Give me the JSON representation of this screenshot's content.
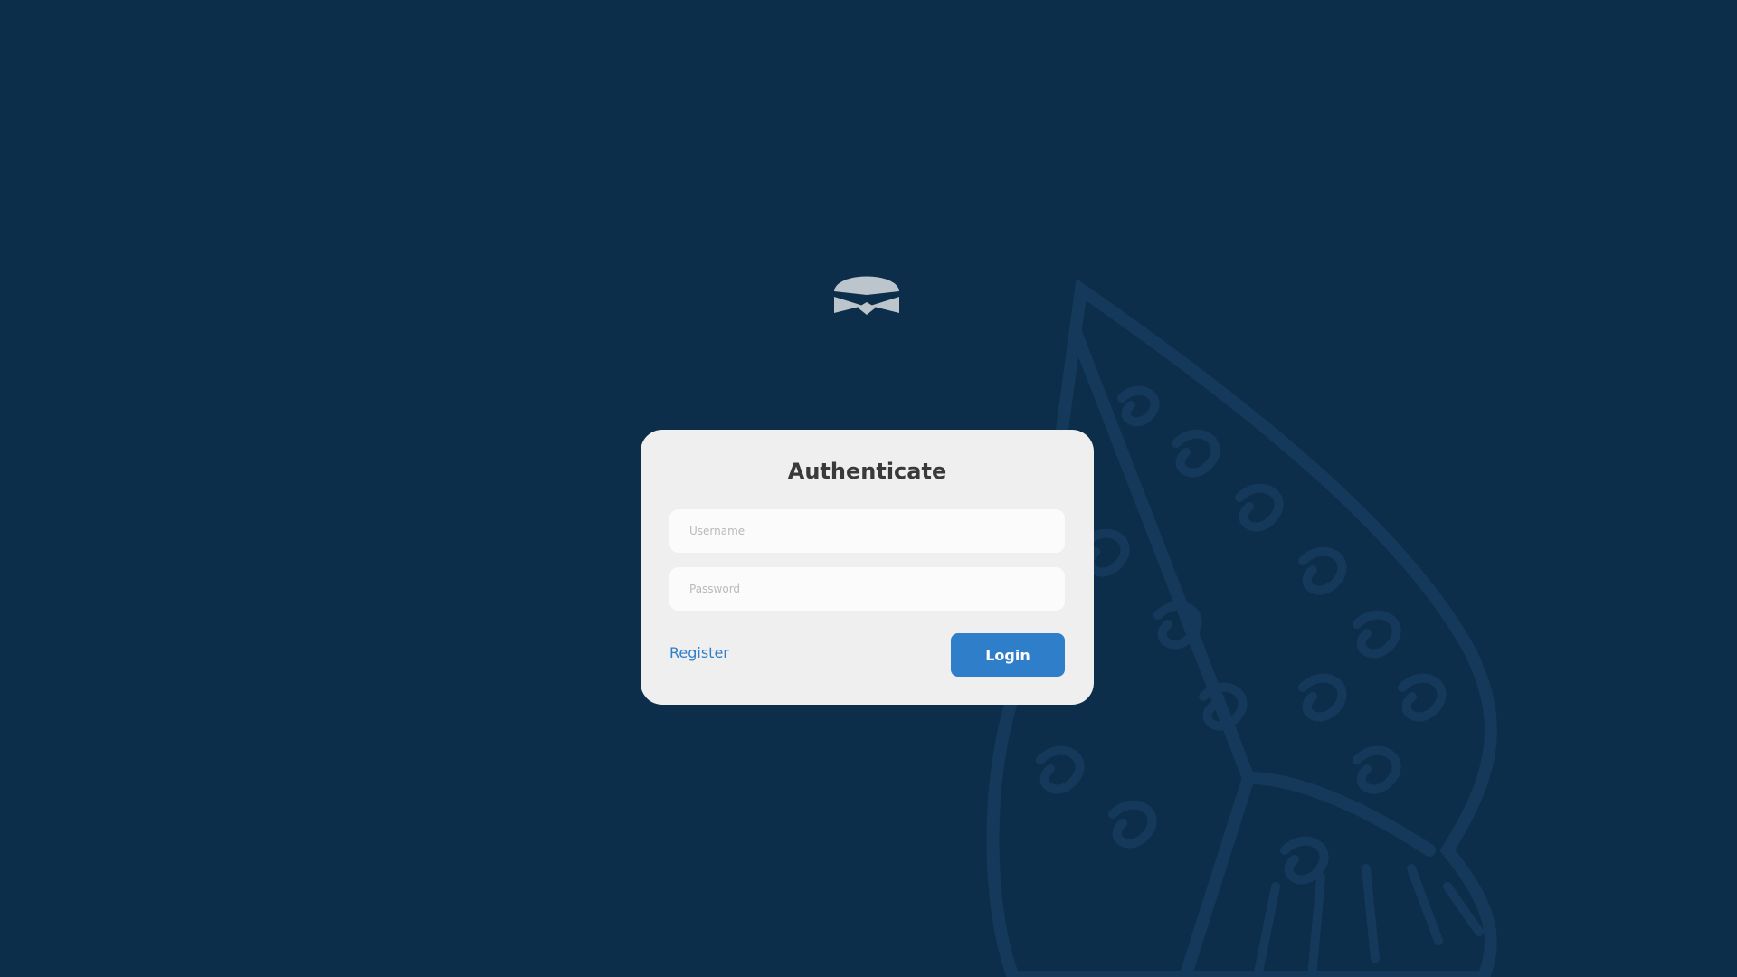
{
  "auth": {
    "title": "Authenticate",
    "username_placeholder": "Username",
    "password_placeholder": "Password",
    "register_label": "Register",
    "login_label": "Login"
  },
  "icons": {
    "logo": "ninja-mask-logo",
    "background": "ornamental-leaf-pattern"
  },
  "colors": {
    "background": "#0c2e4a",
    "card": "#efeff0",
    "accent": "#2e7ec9",
    "title_text": "#3a3a3a",
    "logo": "#bcc5cc"
  }
}
